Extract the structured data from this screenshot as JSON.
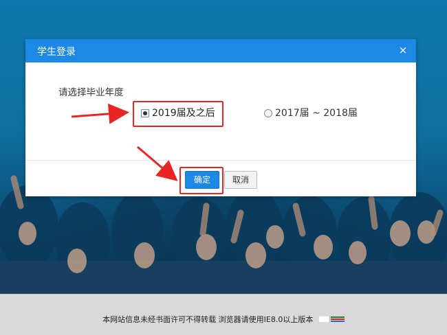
{
  "dialog": {
    "title": "学生登录",
    "close_icon": "×",
    "prompt": "请选择毕业年度",
    "options": [
      {
        "label": "2019届及之后",
        "selected": true
      },
      {
        "label": "2017届 ~ 2018届",
        "selected": false
      }
    ],
    "ok_label": "确定",
    "cancel_label": "取消"
  },
  "footer": {
    "text": "本网站信息未经书面许可不得转载 浏览器请使用IE8.0以上版本"
  },
  "colors": {
    "header": "#1e88e5",
    "annotation": "#e82525"
  }
}
